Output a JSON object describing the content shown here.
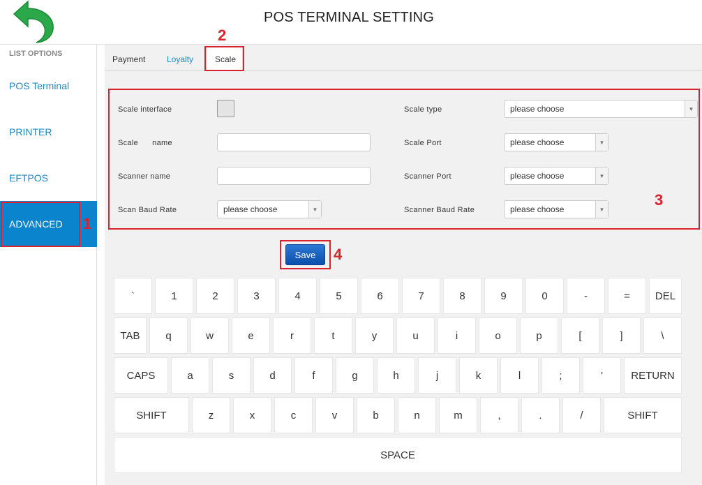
{
  "header": {
    "title": "POS TERMINAL SETTING",
    "back_icon_color": "#2aa84a"
  },
  "sidebar": {
    "title": "LIST OPTIONS",
    "items": [
      {
        "label": "POS Terminal",
        "active": false
      },
      {
        "label": "PRINTER",
        "active": false
      },
      {
        "label": "EFTPOS",
        "active": false
      },
      {
        "label": "ADVANCED",
        "active": true
      }
    ],
    "active_color": "#0a84cc"
  },
  "tabs": [
    {
      "label": "Payment",
      "active": false
    },
    {
      "label": "Loyalty",
      "active": false
    },
    {
      "label": "Scale",
      "active": true
    }
  ],
  "form": {
    "scale_interface": {
      "label": "Scale interface",
      "checked": false
    },
    "scale_name": {
      "label": "Scale      name",
      "value": ""
    },
    "scanner_name": {
      "label": "Scanner name",
      "value": ""
    },
    "scan_baud_rate": {
      "label": "Scan Baud Rate",
      "value": "please choose"
    },
    "scale_type": {
      "label": "Scale type",
      "value": "please choose"
    },
    "scale_port": {
      "label": "Scale Port",
      "value": "please choose"
    },
    "scanner_port": {
      "label": "Scanner Port",
      "value": "please choose"
    },
    "scanner_baud_rate": {
      "label": "Scanner Baud Rate",
      "value": "please choose"
    }
  },
  "save_label": "Save",
  "annotations": {
    "n1": "1",
    "n2": "2",
    "n3": "3",
    "n4": "4",
    "color": "#d9232e"
  },
  "keyboard": {
    "rows": [
      [
        "`",
        "1",
        "2",
        "3",
        "4",
        "5",
        "6",
        "7",
        "8",
        "9",
        "0",
        "-",
        "=",
        "DEL"
      ],
      [
        "TAB",
        "q",
        "w",
        "e",
        "r",
        "t",
        "y",
        "u",
        "i",
        "o",
        "p",
        "[",
        "]",
        "\\"
      ],
      [
        "CAPS",
        "a",
        "s",
        "d",
        "f",
        "g",
        "h",
        "j",
        "k",
        "l",
        ";",
        "'",
        "RETURN"
      ],
      [
        "SHIFT",
        "z",
        "x",
        "c",
        "v",
        "b",
        "n",
        "m",
        ",",
        ".",
        "/",
        "SHIFT"
      ],
      [
        "SPACE"
      ]
    ]
  }
}
